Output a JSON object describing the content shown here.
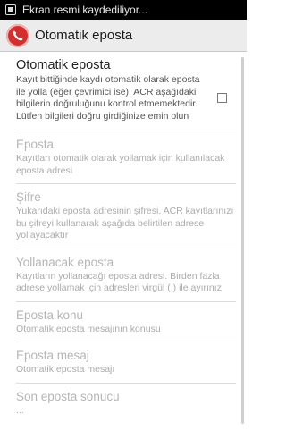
{
  "status_bar": {
    "notification_icon": "screenshot-icon",
    "text": "Ekran resmi kaydediliyor..."
  },
  "action_bar": {
    "app_icon": "phone-call-icon",
    "title": "Otomatik eposta",
    "accent": "#d32f2f"
  },
  "preferences": [
    {
      "title": "Otomatik eposta",
      "summary": "Kayıt bittiğinde kaydı otomatik olarak eposta ile yolla (eğer çevrimici ise). ACR aşağıdaki bilgilerin doğruluğunu kontrol etmemektedir. Lütfen bilgileri doğru girdiğinize emin olun",
      "checked": false,
      "enabled": true
    },
    {
      "title": "Eposta",
      "summary": "Kayıtları otomatik olarak yollamak için kullanılacak eposta adresi",
      "enabled": false
    },
    {
      "title": "Şifre",
      "summary": "Yukarıdaki eposta adresinin şifresi. ACR kayıtlarınızı bu şifreyi kullanarak aşağıda belirtilen adrese yollayacaktır",
      "enabled": false
    },
    {
      "title": "Yollanacak eposta",
      "summary": "Kayıtların yollanacağı eposta adresi. Birden fazla adrese yollamak için adresleri virgül (,) ile ayırınız",
      "enabled": false
    },
    {
      "title": "Eposta konu",
      "summary": "Otomatik eposta mesajının konusu",
      "enabled": false
    },
    {
      "title": "Eposta mesaj",
      "summary": "Otomatik eposta mesajı",
      "enabled": false
    },
    {
      "title": "Son eposta sonucu",
      "summary": "...",
      "enabled": false
    }
  ]
}
